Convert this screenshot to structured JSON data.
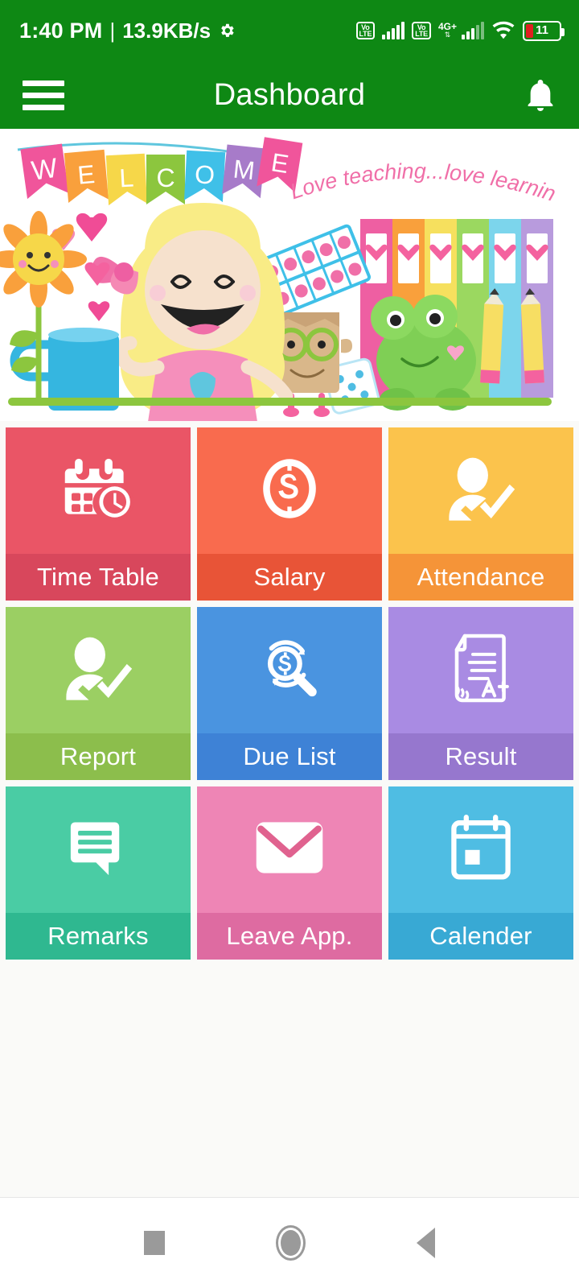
{
  "status_bar": {
    "time": "1:40 PM",
    "separator": "|",
    "network_speed": "13.9KB/s",
    "gear_icon": "gear-icon",
    "sim1_volte_top": "Vo",
    "sim1_volte_bottom": "LTE",
    "sim2_volte_top": "Vo",
    "sim2_volte_bottom": "LTE",
    "network_type": "4G+",
    "network_arrows": "⇅",
    "wifi_icon": "wifi-icon",
    "battery_percent": "11",
    "battery_color": "#E02020"
  },
  "app_bar": {
    "menu_icon": "hamburger-menu-icon",
    "title": "Dashboard",
    "notification_icon": "bell-icon",
    "background_color": "#0E8814"
  },
  "banner": {
    "welcome_letters": [
      "W",
      "E",
      "L",
      "C",
      "O",
      "M",
      "E"
    ],
    "flag_colors": [
      "#F0559B",
      "#F9A03C",
      "#F6D749",
      "#8CC63E",
      "#3FC0E8",
      "#A77BC9",
      "#F0559B"
    ],
    "tagline": "Love teaching...love learning!",
    "tagline_color": "#F06FA8",
    "illustration": "classroom-welcome-illustration"
  },
  "tiles": [
    {
      "label": "Time Table",
      "icon": "calendar-clock-icon",
      "color": "#EA5566",
      "label_color": "#D8475C"
    },
    {
      "label": "Salary",
      "icon": "dollar-circle-icon",
      "color": "#F96B4E",
      "label_color": "#E85437"
    },
    {
      "label": "Attendance",
      "icon": "person-check-icon",
      "color": "#FBC34C",
      "label_color": "#F59438"
    },
    {
      "label": "Report",
      "icon": "person-check-icon",
      "color": "#9BCF63",
      "label_color": "#8CBE4C"
    },
    {
      "label": "Due List",
      "icon": "dollar-search-icon",
      "color": "#4A94E0",
      "label_color": "#3E82D6"
    },
    {
      "label": "Result",
      "icon": "document-grade-icon",
      "color": "#A98BE3",
      "label_color": "#9677CE"
    },
    {
      "label": "Remarks",
      "icon": "chat-bubble-icon",
      "color": "#4ACCA4",
      "label_color": "#2FB890"
    },
    {
      "label": "Leave App.",
      "icon": "envelope-icon",
      "color": "#EE85B5",
      "label_color": "#DE6BA1"
    },
    {
      "label": "Calender",
      "icon": "calendar-icon",
      "color": "#4FBDE3",
      "label_color": "#38A9D4"
    }
  ],
  "nav_bar": {
    "recents_label": "Recents",
    "home_label": "Home",
    "back_label": "Back",
    "icon_color": "#9A9A9A"
  }
}
